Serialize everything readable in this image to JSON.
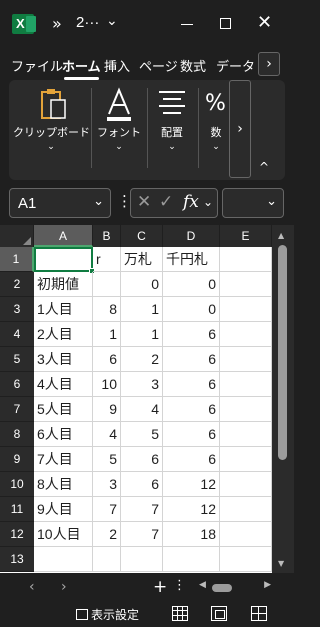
{
  "titlebar": {
    "app_icon": "excel-icon",
    "app_letter": "X",
    "overflow_label": "»",
    "file_name": "2···",
    "menu_chevron": "⌄",
    "minimize_icon": "minimize-icon",
    "maximize_icon": "maximize-icon",
    "close_label": "✕"
  },
  "ribbon_tabs": [
    "ファイル",
    "ホーム",
    "挿入",
    "ページ",
    "数式",
    "データ"
  ],
  "ribbon_tabs_active": "ホーム",
  "ribbon_tabs_more": "›",
  "ribbon_groups": {
    "clipboard": "クリップボード",
    "font": "フォント",
    "alignment": "配置",
    "number": "数"
  },
  "ribbon_more": "›",
  "ribbon_collapse": "^",
  "formula_bar": {
    "name_box": "A1",
    "name_box_dropdown": "⌄",
    "more": "⋮",
    "cancel": "✕",
    "enter": "✓",
    "fx": "fx",
    "fx_dropdown": "⌄",
    "formula_value": "",
    "expand": "⌄"
  },
  "columns": [
    "A",
    "B",
    "C",
    "D",
    "E"
  ],
  "selected_column": "A",
  "rows": [
    {
      "num": "1",
      "a": "",
      "b": "r",
      "c": "万札",
      "d": "千円札"
    },
    {
      "num": "2",
      "a": "初期値",
      "b": "",
      "c": "0",
      "d": "0"
    },
    {
      "num": "3",
      "a": "1人目",
      "b": "8",
      "c": "1",
      "d": "0"
    },
    {
      "num": "4",
      "a": "2人目",
      "b": "1",
      "c": "1",
      "d": "6"
    },
    {
      "num": "5",
      "a": "3人目",
      "b": "6",
      "c": "2",
      "d": "6"
    },
    {
      "num": "6",
      "a": "4人目",
      "b": "10",
      "c": "3",
      "d": "6"
    },
    {
      "num": "7",
      "a": "5人目",
      "b": "9",
      "c": "4",
      "d": "6"
    },
    {
      "num": "8",
      "a": "6人目",
      "b": "4",
      "c": "5",
      "d": "6"
    },
    {
      "num": "9",
      "a": "7人目",
      "b": "5",
      "c": "6",
      "d": "6"
    },
    {
      "num": "10",
      "a": "8人目",
      "b": "3",
      "c": "6",
      "d": "12"
    },
    {
      "num": "11",
      "a": "9人目",
      "b": "7",
      "c": "7",
      "d": "12"
    },
    {
      "num": "12",
      "a": "10人目",
      "b": "2",
      "c": "7",
      "d": "18"
    },
    {
      "num": "13",
      "a": "",
      "b": "",
      "c": "",
      "d": ""
    }
  ],
  "selected_row": "1",
  "sheet_nav": {
    "prev": "‹",
    "next": "›",
    "add_sheet": "+",
    "more": "⋮"
  },
  "status": {
    "display_settings": "表示設定"
  },
  "accent_color": "#107c41"
}
